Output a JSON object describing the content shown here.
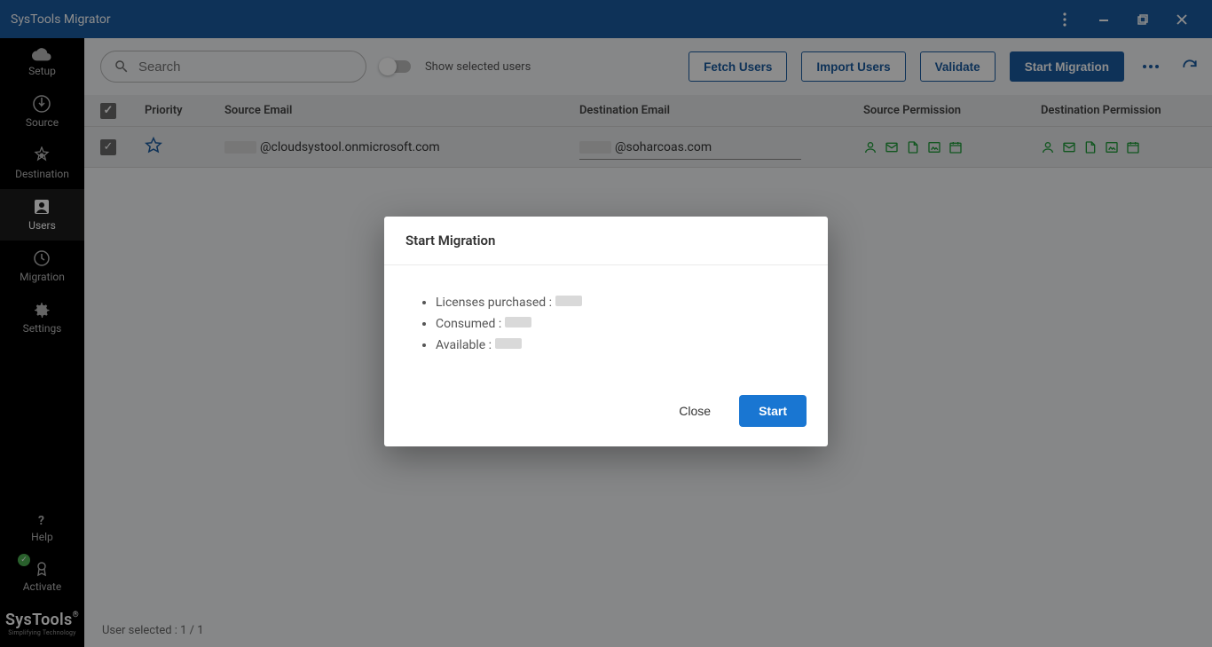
{
  "titlebar": {
    "title": "SysTools Migrator"
  },
  "sidebar": {
    "items": [
      {
        "label": "Setup"
      },
      {
        "label": "Source"
      },
      {
        "label": "Destination"
      },
      {
        "label": "Users"
      },
      {
        "label": "Migration"
      },
      {
        "label": "Settings"
      }
    ],
    "help_label": "Help",
    "activate_label": "Activate",
    "brand_main": "SysTools",
    "brand_sub": "Simplifying Technology"
  },
  "toolbar": {
    "search_placeholder": "Search",
    "show_selected_label": "Show selected users",
    "fetch_label": "Fetch Users",
    "import_label": "Import Users",
    "validate_label": "Validate",
    "start_label": "Start Migration"
  },
  "table": {
    "headers": {
      "priority": "Priority",
      "source": "Source Email",
      "destination": "Destination Email",
      "sp": "Source Permission",
      "dp": "Destination Permission"
    },
    "rows": [
      {
        "source_suffix": "@cloudsystool.onmicrosoft.com",
        "dest_suffix": "@soharcoas.com"
      }
    ]
  },
  "footer": {
    "selected_text": "User selected : 1 / 1"
  },
  "modal": {
    "title": "Start Migration",
    "licenses_label": "Licenses purchased :",
    "consumed_label": "Consumed :",
    "available_label": "Available :",
    "close_label": "Close",
    "start_label": "Start"
  }
}
